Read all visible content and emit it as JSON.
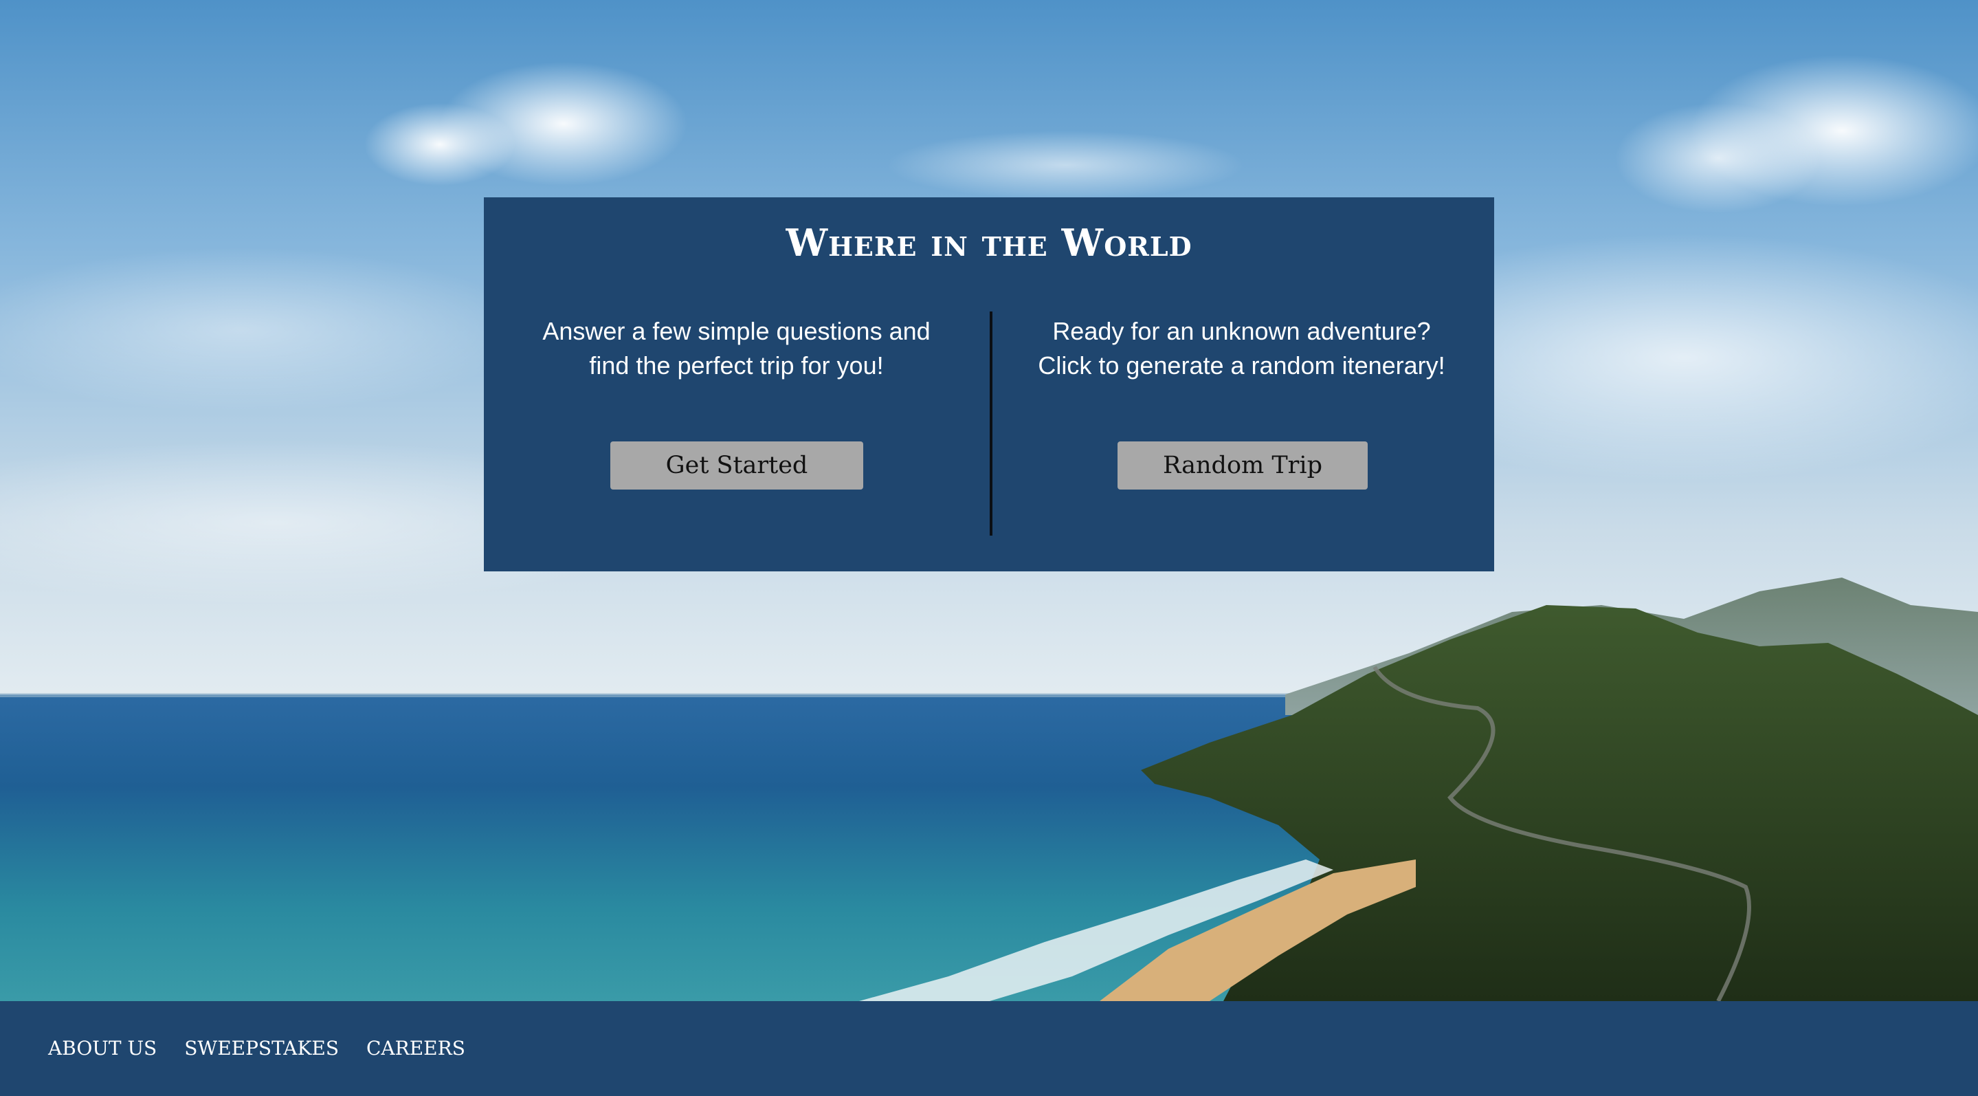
{
  "card": {
    "title": "Where in the World",
    "left_text_line1": "Answer a few simple questions and",
    "left_text_line2": "find the perfect trip for you!",
    "right_text_line1": "Ready for an unknown adventure?",
    "right_text_line2": "Click to generate a random itenerary!",
    "get_started_label": "Get Started",
    "random_trip_label": "Random Trip"
  },
  "footer": {
    "links": [
      {
        "label": "ABOUT US"
      },
      {
        "label": "SWEEPSTAKES"
      },
      {
        "label": "CAREERS"
      }
    ]
  },
  "colors": {
    "panel": "#1f466f",
    "button": "#a8a8a8",
    "divider": "#0b0f14"
  }
}
